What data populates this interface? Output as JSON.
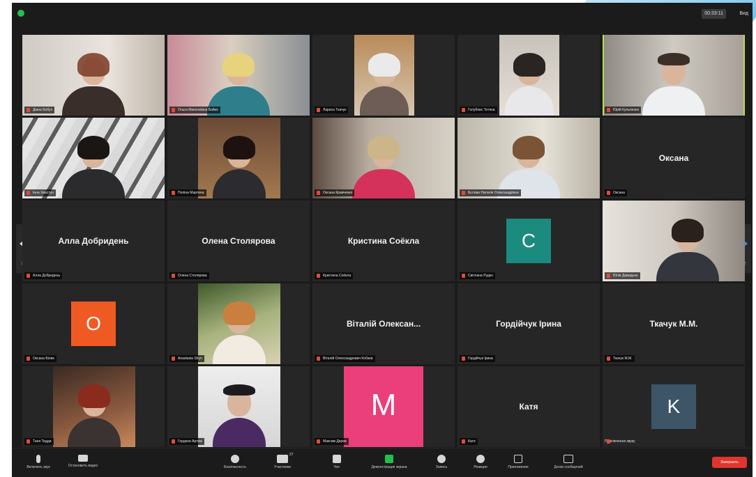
{
  "window": {
    "timer": "00:33:11",
    "view_label": "Вид"
  },
  "tiles": [
    {
      "label": "Діана Бобух"
    },
    {
      "label": "Ольга Миколаївна Бойко"
    },
    {
      "label": "Лариса Ткачук"
    },
    {
      "label": "Голубовс Тетяна"
    },
    {
      "label": "Юрій Кульпенко"
    },
    {
      "label": "Інна Хвастун"
    },
    {
      "label": "Поліна Мартина"
    },
    {
      "label": "Оксана Кравченко"
    },
    {
      "label": "Бєлова Наталія Олександрівна"
    },
    {
      "name": "Оксана",
      "label": "Оксана"
    },
    {
      "name": "Алла Добридень",
      "label": "Алла Добридень"
    },
    {
      "name": "Олена Столярова",
      "label": "Олена Столярова"
    },
    {
      "name": "Кристина Соёкла",
      "label": "Кристина Соёкла"
    },
    {
      "avatar": "С",
      "label": "Світлана Рудко"
    },
    {
      "label": "Юлія Давидьон"
    },
    {
      "avatar": "О",
      "label": "Оксана Білик"
    },
    {
      "label": "Anastasia Shyn"
    },
    {
      "name": "Віталій Олексан...",
      "label": "Віталій Олександрович Кобзев"
    },
    {
      "name": "Гордійчук Ірина",
      "label": "Гордійчук Ірина"
    },
    {
      "name": "Ткачук М.М.",
      "label": "Ткачук М.М."
    },
    {
      "label": "Таня Тедди"
    },
    {
      "label": "Гордеєв Артем"
    },
    {
      "avatar": "M",
      "label": "Максим Дерев"
    },
    {
      "name": "Катя",
      "label": "Катя"
    },
    {
      "avatar": "K",
      "label": "Підключення звуку"
    }
  ],
  "pager": {
    "left": "1/2",
    "right": "1/2"
  },
  "toolbar": {
    "mute": "Включить звук",
    "video": "Остановить видео",
    "security": "Безопасность",
    "participants": "Участники",
    "participants_count": "27",
    "chat": "Чат",
    "share": "Демонстрация экрана",
    "record": "Запись",
    "reactions": "Реакции",
    "apps": "Приложения",
    "whiteboard": "Доски сообщений",
    "end": "Завершить"
  },
  "colors": {
    "avatar_c": "#1b8a7f",
    "avatar_o": "#ef5a23",
    "avatar_m": "#ea3f7a",
    "avatar_k": "#3d5566",
    "active_border": "#b6e04a",
    "end_button": "#e0352f"
  }
}
